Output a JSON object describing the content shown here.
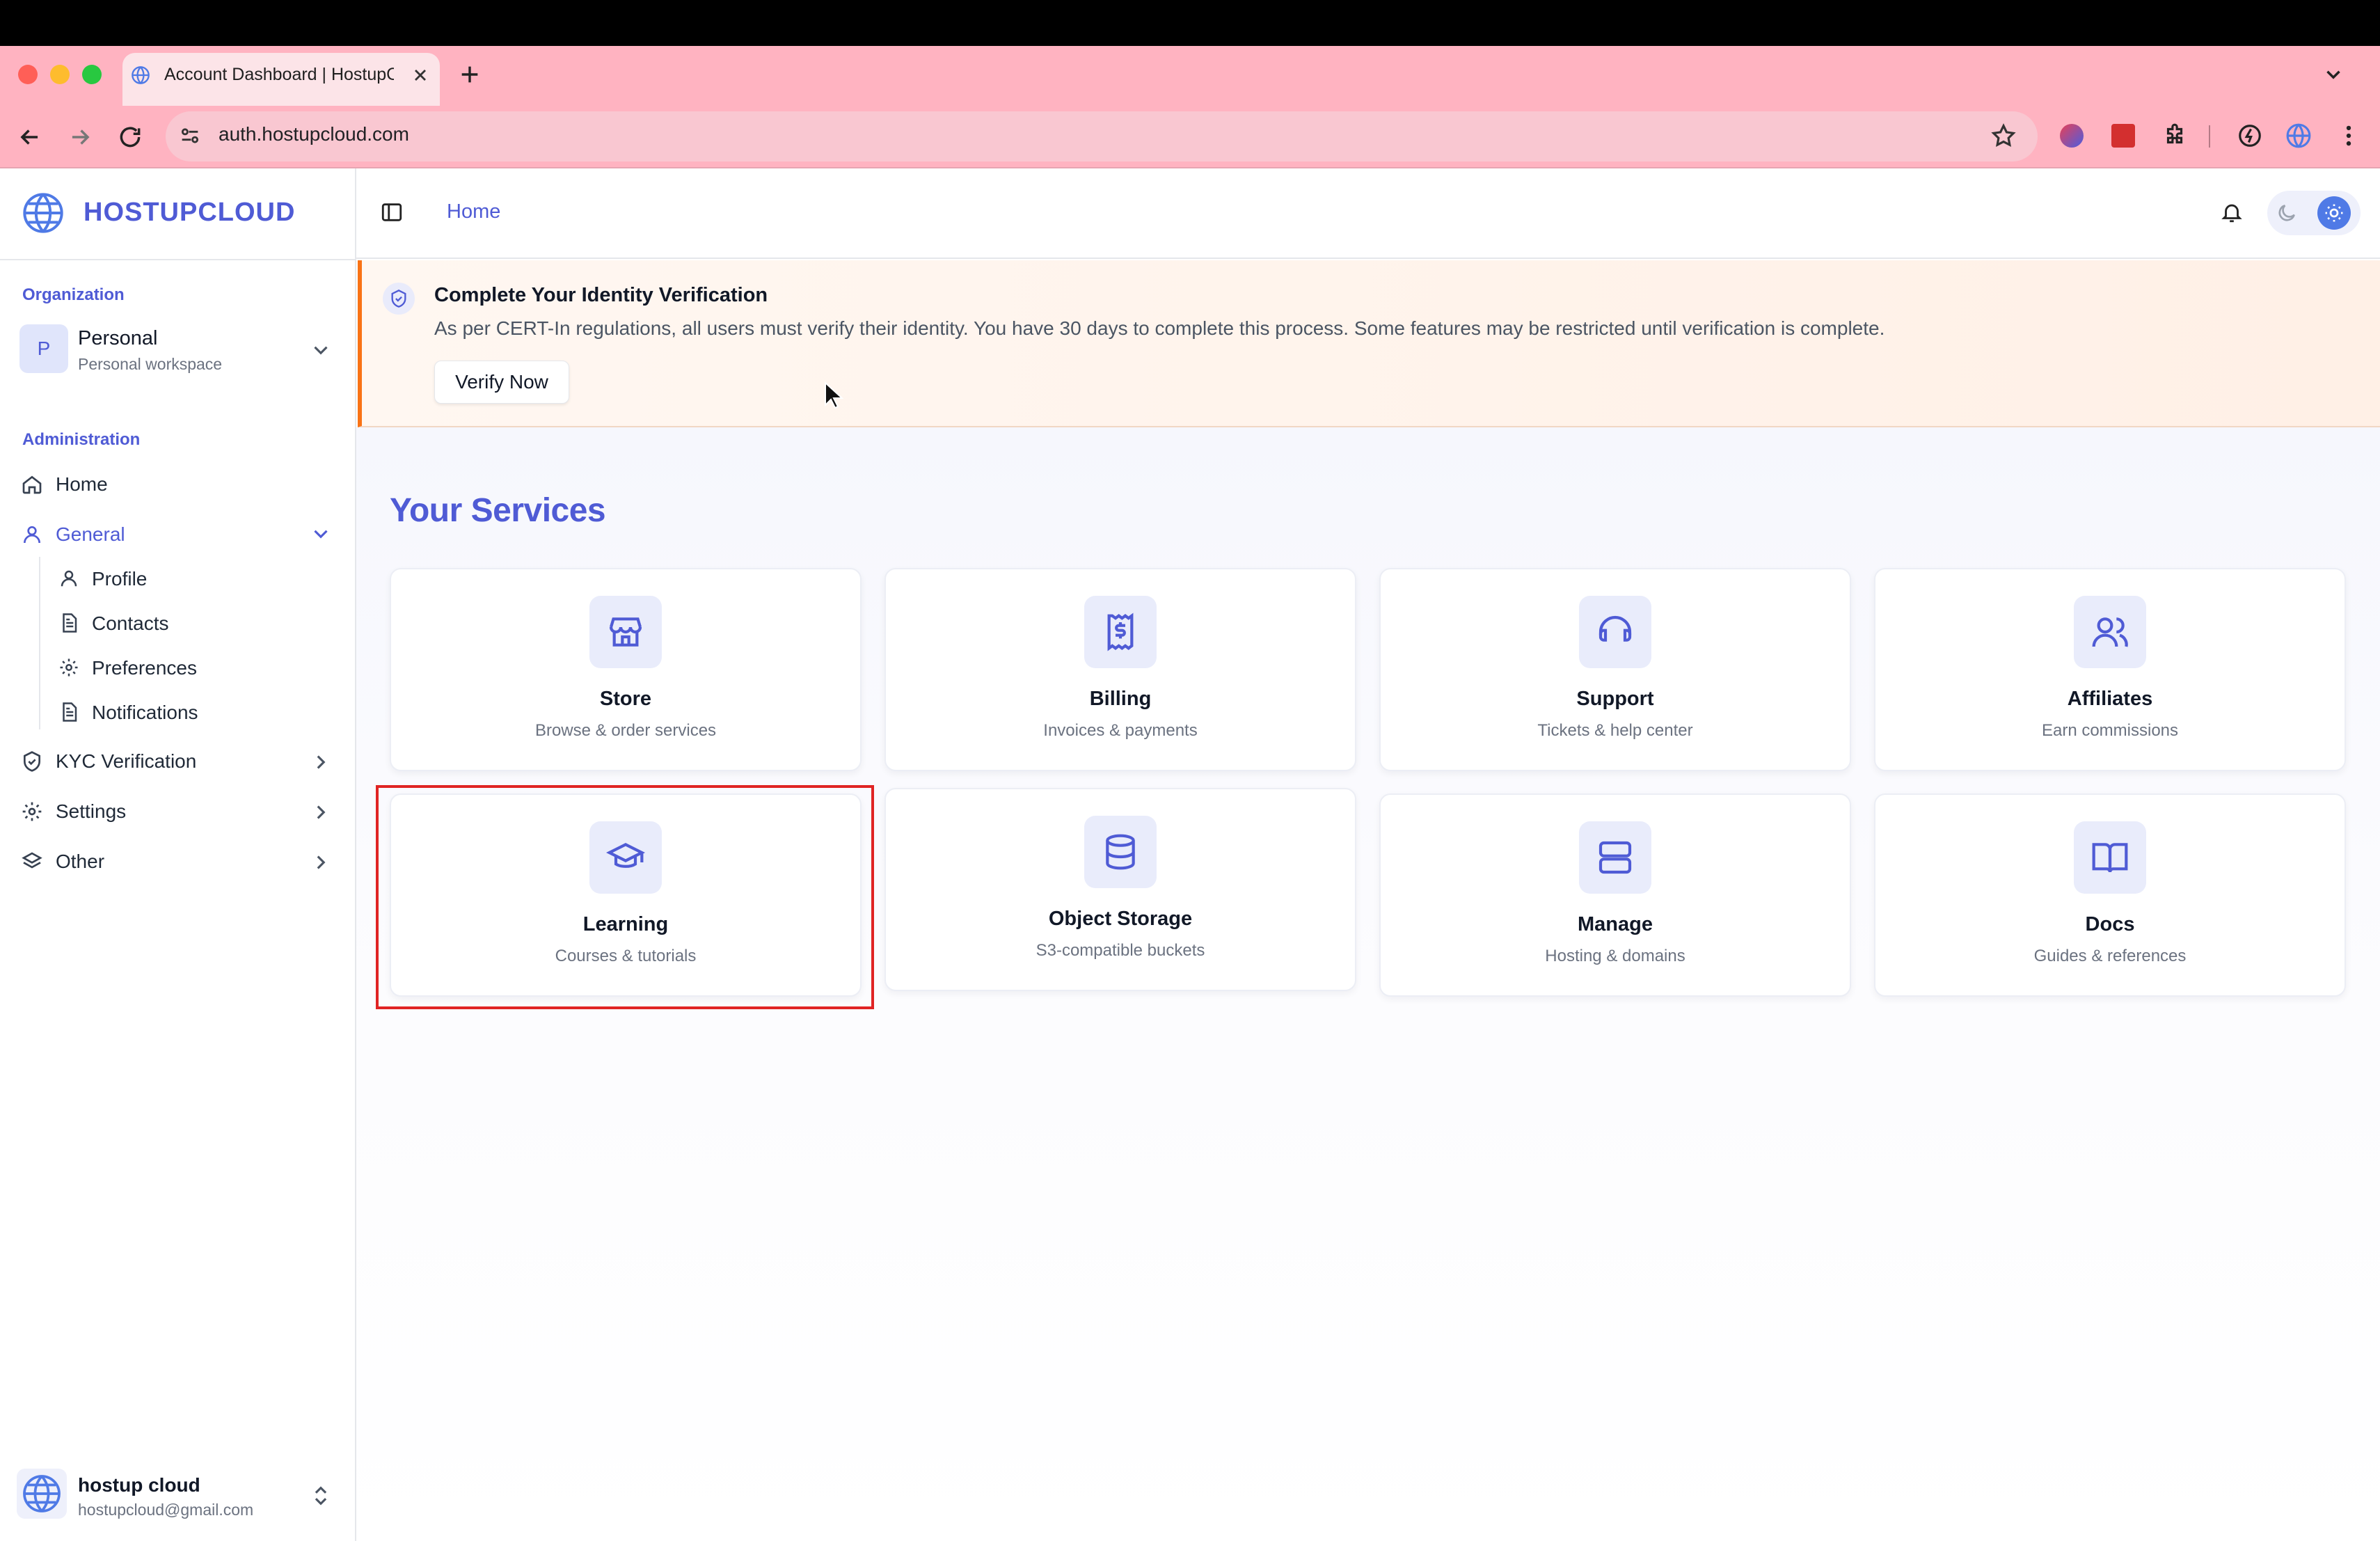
{
  "browser": {
    "tab_title": "Account Dashboard | HostupC",
    "url": "auth.hostupcloud.com"
  },
  "brand": {
    "name": "HOSTUPCLOUD"
  },
  "sidebar": {
    "organization_label": "Organization",
    "org": {
      "avatar_letter": "P",
      "name": "Personal",
      "subtitle": "Personal workspace"
    },
    "administration_label": "Administration",
    "items": [
      {
        "label": "Home",
        "icon": "home-icon"
      },
      {
        "label": "General",
        "icon": "user-icon",
        "expanded": true
      },
      {
        "label": "KYC Verification",
        "icon": "shield-check-icon"
      },
      {
        "label": "Settings",
        "icon": "gear-icon"
      },
      {
        "label": "Other",
        "icon": "layers-icon"
      }
    ],
    "general_subitems": [
      {
        "label": "Profile",
        "icon": "user-icon"
      },
      {
        "label": "Contacts",
        "icon": "document-icon"
      },
      {
        "label": "Preferences",
        "icon": "gear-icon"
      },
      {
        "label": "Notifications",
        "icon": "document-icon"
      }
    ],
    "user": {
      "name": "hostup cloud",
      "email": "hostupcloud@gmail.com"
    }
  },
  "header": {
    "breadcrumb": "Home"
  },
  "kyc_banner": {
    "title": "Complete Your Identity Verification",
    "text": "As per CERT-In regulations, all users must verify their identity. You have 30 days to complete this process. Some features may be restricted until verification is complete.",
    "button": "Verify Now"
  },
  "services": {
    "title": "Your Services",
    "cards": [
      {
        "title": "Store",
        "subtitle": "Browse & order services",
        "icon": "store-icon"
      },
      {
        "title": "Billing",
        "subtitle": "Invoices & payments",
        "icon": "receipt-dollar-icon"
      },
      {
        "title": "Support",
        "subtitle": "Tickets & help center",
        "icon": "headphones-icon"
      },
      {
        "title": "Affiliates",
        "subtitle": "Earn commissions",
        "icon": "users-icon"
      },
      {
        "title": "Learning",
        "subtitle": "Courses & tutorials",
        "icon": "graduation-cap-icon"
      },
      {
        "title": "Object Storage",
        "subtitle": "S3-compatible buckets",
        "icon": "database-icon"
      },
      {
        "title": "Manage",
        "subtitle": "Hosting & domains",
        "icon": "server-icon"
      },
      {
        "title": "Docs",
        "subtitle": "Guides & references",
        "icon": "book-open-icon"
      }
    ]
  },
  "colors": {
    "accent": "#4f5bd5",
    "banner_border": "#f97316",
    "highlight": "#e02424"
  }
}
